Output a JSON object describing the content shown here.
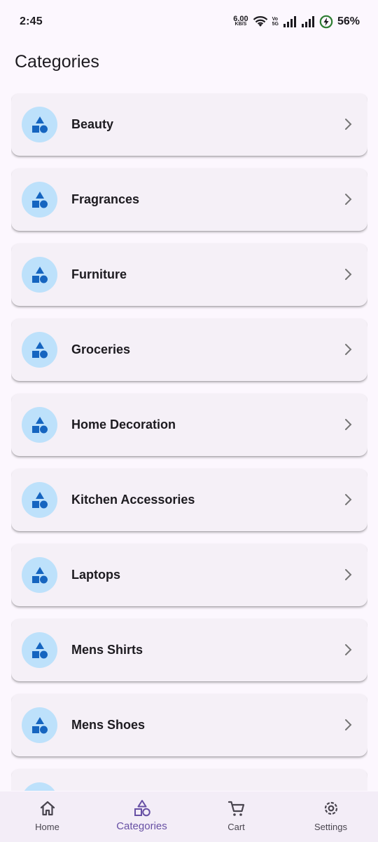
{
  "status_bar": {
    "time": "2:45",
    "net_speed_value": "6.00",
    "net_speed_unit": "KB/S",
    "volte_top": "Vo",
    "volte_bottom": "5G",
    "battery_percent": "56%"
  },
  "page": {
    "title": "Categories"
  },
  "categories": [
    {
      "label": "Beauty"
    },
    {
      "label": "Fragrances"
    },
    {
      "label": "Furniture"
    },
    {
      "label": "Groceries"
    },
    {
      "label": "Home Decoration"
    },
    {
      "label": "Kitchen Accessories"
    },
    {
      "label": "Laptops"
    },
    {
      "label": "Mens Shirts"
    },
    {
      "label": "Mens Shoes"
    },
    {
      "label": ""
    }
  ],
  "category_icon": "category-shapes-icon",
  "bottom_nav": {
    "items": [
      {
        "label": "Home",
        "icon": "home-icon"
      },
      {
        "label": "Categories",
        "icon": "category-icon"
      },
      {
        "label": "Cart",
        "icon": "cart-icon"
      },
      {
        "label": "Settings",
        "icon": "settings-icon"
      }
    ],
    "active_index": 1
  },
  "colors": {
    "background": "#fcf7fe",
    "card": "#f5f0f7",
    "avatar_bg": "#bde1fb",
    "icon_blue": "#1565c0",
    "active_nav": "#6750a4",
    "inactive_nav": "#49454f",
    "nav_bar": "#f3edf7"
  }
}
